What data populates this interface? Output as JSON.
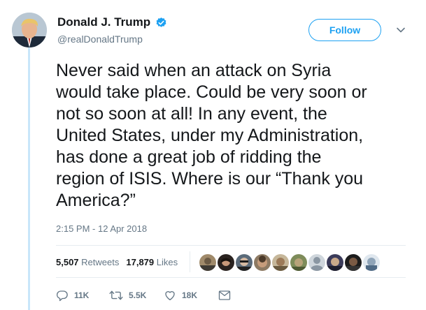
{
  "author": {
    "name": "Donald J. Trump",
    "handle": "@realDonaldTrump"
  },
  "follow_label": "Follow",
  "tweet": {
    "lines": [
      "Never said when an attack on Syria",
      "would take place. Could be very soon or",
      "not so soon at all! In any event, the",
      "United States, under my Administration,",
      "has done a great job of ridding the",
      "region of ISIS. Where is our “Thank you",
      "America?”"
    ],
    "timestamp": "2:15 PM - 12 Apr 2018"
  },
  "stats": {
    "retweets_count": "5,507",
    "retweets_label": "Retweets",
    "likes_count": "17,879",
    "likes_label": "Likes"
  },
  "actions": {
    "replies": "11K",
    "retweets": "5.5K",
    "likes": "18K"
  },
  "colors": {
    "accent": "#1da1f2",
    "thread_line": "#c8e6fa",
    "secondary_text": "#657786",
    "primary_text": "#14171a",
    "divider": "#e6ecf0"
  },
  "icons": {
    "verified": "verified-badge-icon",
    "caret": "chevron-down-icon",
    "reply": "reply-icon",
    "retweet": "retweet-icon",
    "like": "heart-icon",
    "message": "direct-message-icon"
  }
}
